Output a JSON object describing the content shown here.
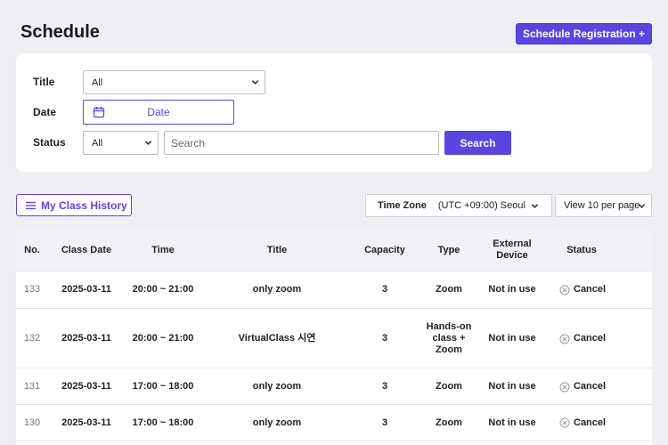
{
  "header": {
    "title": "Schedule",
    "register_button": "Schedule Registration +"
  },
  "filters": {
    "title_label": "Title",
    "title_select": "All",
    "date_label": "Date",
    "date_placeholder": "Date",
    "status_label": "Status",
    "status_select": "All",
    "search_placeholder": "Search",
    "search_button": "Search"
  },
  "toolbar": {
    "history_button": "My Class History",
    "timezone_label": "Time Zone",
    "timezone_value": "(UTC +09:00) Seoul",
    "per_page": "View 10 per page"
  },
  "table": {
    "columns": [
      "No.",
      "Class Date",
      "Time",
      "Title",
      "Capacity",
      "Type",
      "External Device",
      "Status"
    ],
    "rows": [
      {
        "no": "133",
        "date": "2025-03-11",
        "time": "20:00 ~ 21:00",
        "title": "only zoom",
        "capacity": "3",
        "type": "Zoom",
        "device": "Not in use",
        "status": "Cancel"
      },
      {
        "no": "132",
        "date": "2025-03-11",
        "time": "20:00 ~ 21:00",
        "title": "VirtualClass 시연",
        "capacity": "3",
        "type": "Hands-on class + Zoom",
        "device": "Not in use",
        "status": "Cancel"
      },
      {
        "no": "131",
        "date": "2025-03-11",
        "time": "17:00 ~ 18:00",
        "title": "only zoom",
        "capacity": "3",
        "type": "Zoom",
        "device": "Not in use",
        "status": "Cancel"
      },
      {
        "no": "130",
        "date": "2025-03-11",
        "time": "17:00 ~ 18:00",
        "title": "only zoom",
        "capacity": "3",
        "type": "Zoom",
        "device": "Not in use",
        "status": "Cancel"
      }
    ]
  },
  "colors": {
    "accent": "#5b45e0",
    "background": "#eeeef3"
  }
}
